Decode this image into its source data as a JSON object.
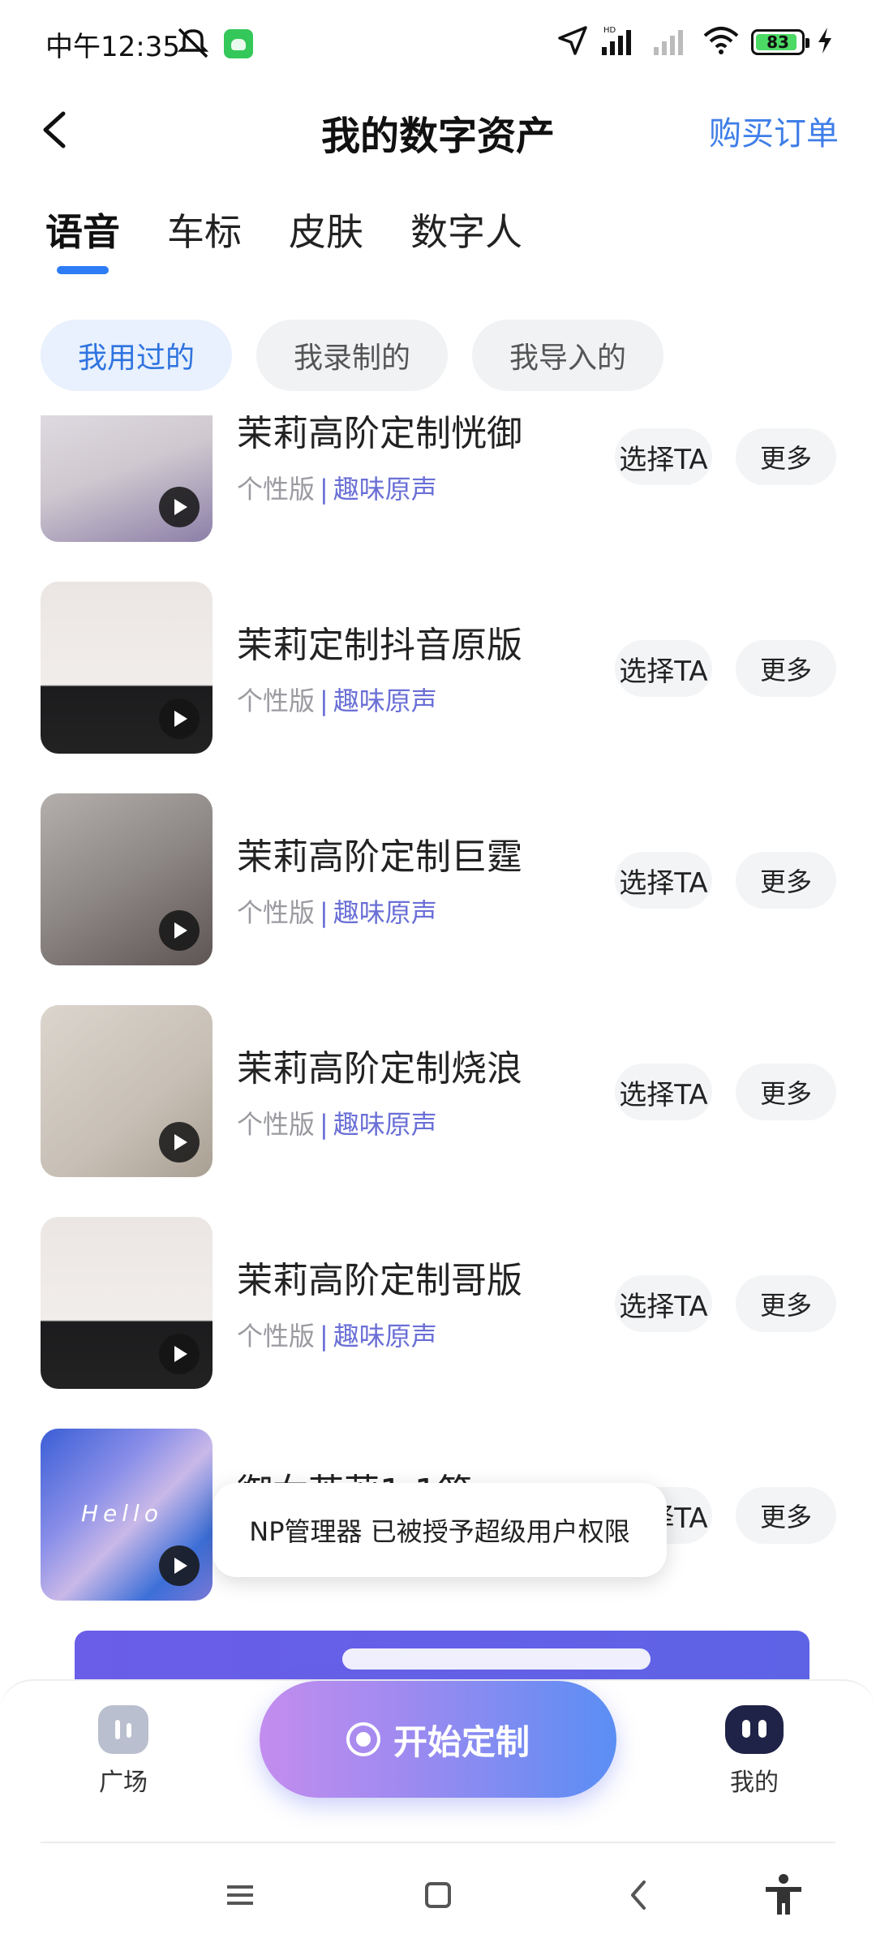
{
  "status_bar": {
    "time": "中午12:35",
    "battery_level": "83",
    "icons": [
      "mute-icon",
      "app-notification-icon",
      "location-icon",
      "signal-hd-icon",
      "signal-weak-icon",
      "wifi-icon",
      "battery-icon",
      "charging-icon"
    ]
  },
  "header": {
    "title": "我的数字资产",
    "orders_link": "购买订单"
  },
  "tabs": [
    {
      "label": "语音",
      "active": true
    },
    {
      "label": "车标",
      "active": false
    },
    {
      "label": "皮肤",
      "active": false
    },
    {
      "label": "数字人",
      "active": false
    }
  ],
  "filters": [
    {
      "label": "我用过的",
      "active": true
    },
    {
      "label": "我录制的",
      "active": false
    },
    {
      "label": "我导入的",
      "active": false
    }
  ],
  "list": {
    "select_label": "选择TA",
    "more_label": "更多",
    "items": [
      {
        "name": "茉莉高阶定制恍御",
        "edition": "个性版",
        "separator": "|",
        "category": "趣味原声"
      },
      {
        "name": "茉莉定制抖音原版",
        "edition": "个性版",
        "separator": "|",
        "category": "趣味原声"
      },
      {
        "name": "茉莉高阶定制巨霆",
        "edition": "个性版",
        "separator": "|",
        "category": "趣味原声"
      },
      {
        "name": "茉莉高阶定制烧浪",
        "edition": "个性版",
        "separator": "|",
        "category": "趣味原声"
      },
      {
        "name": "茉莉高阶定制哥版",
        "edition": "个性版",
        "separator": "|",
        "category": "趣味原声"
      },
      {
        "name": "御女茉莉1:1简",
        "edition": "",
        "separator": "",
        "category": "",
        "thumb_text": "Hello"
      }
    ]
  },
  "toast": "NP管理器 已被授予超级用户权限",
  "bottom_nav": {
    "plaza_label": "广场",
    "start_label": "开始定制",
    "mine_label": "我的"
  },
  "colors": {
    "accent": "#2e7cf6",
    "link": "#3f7ee8",
    "category": "#6a6fd6"
  }
}
